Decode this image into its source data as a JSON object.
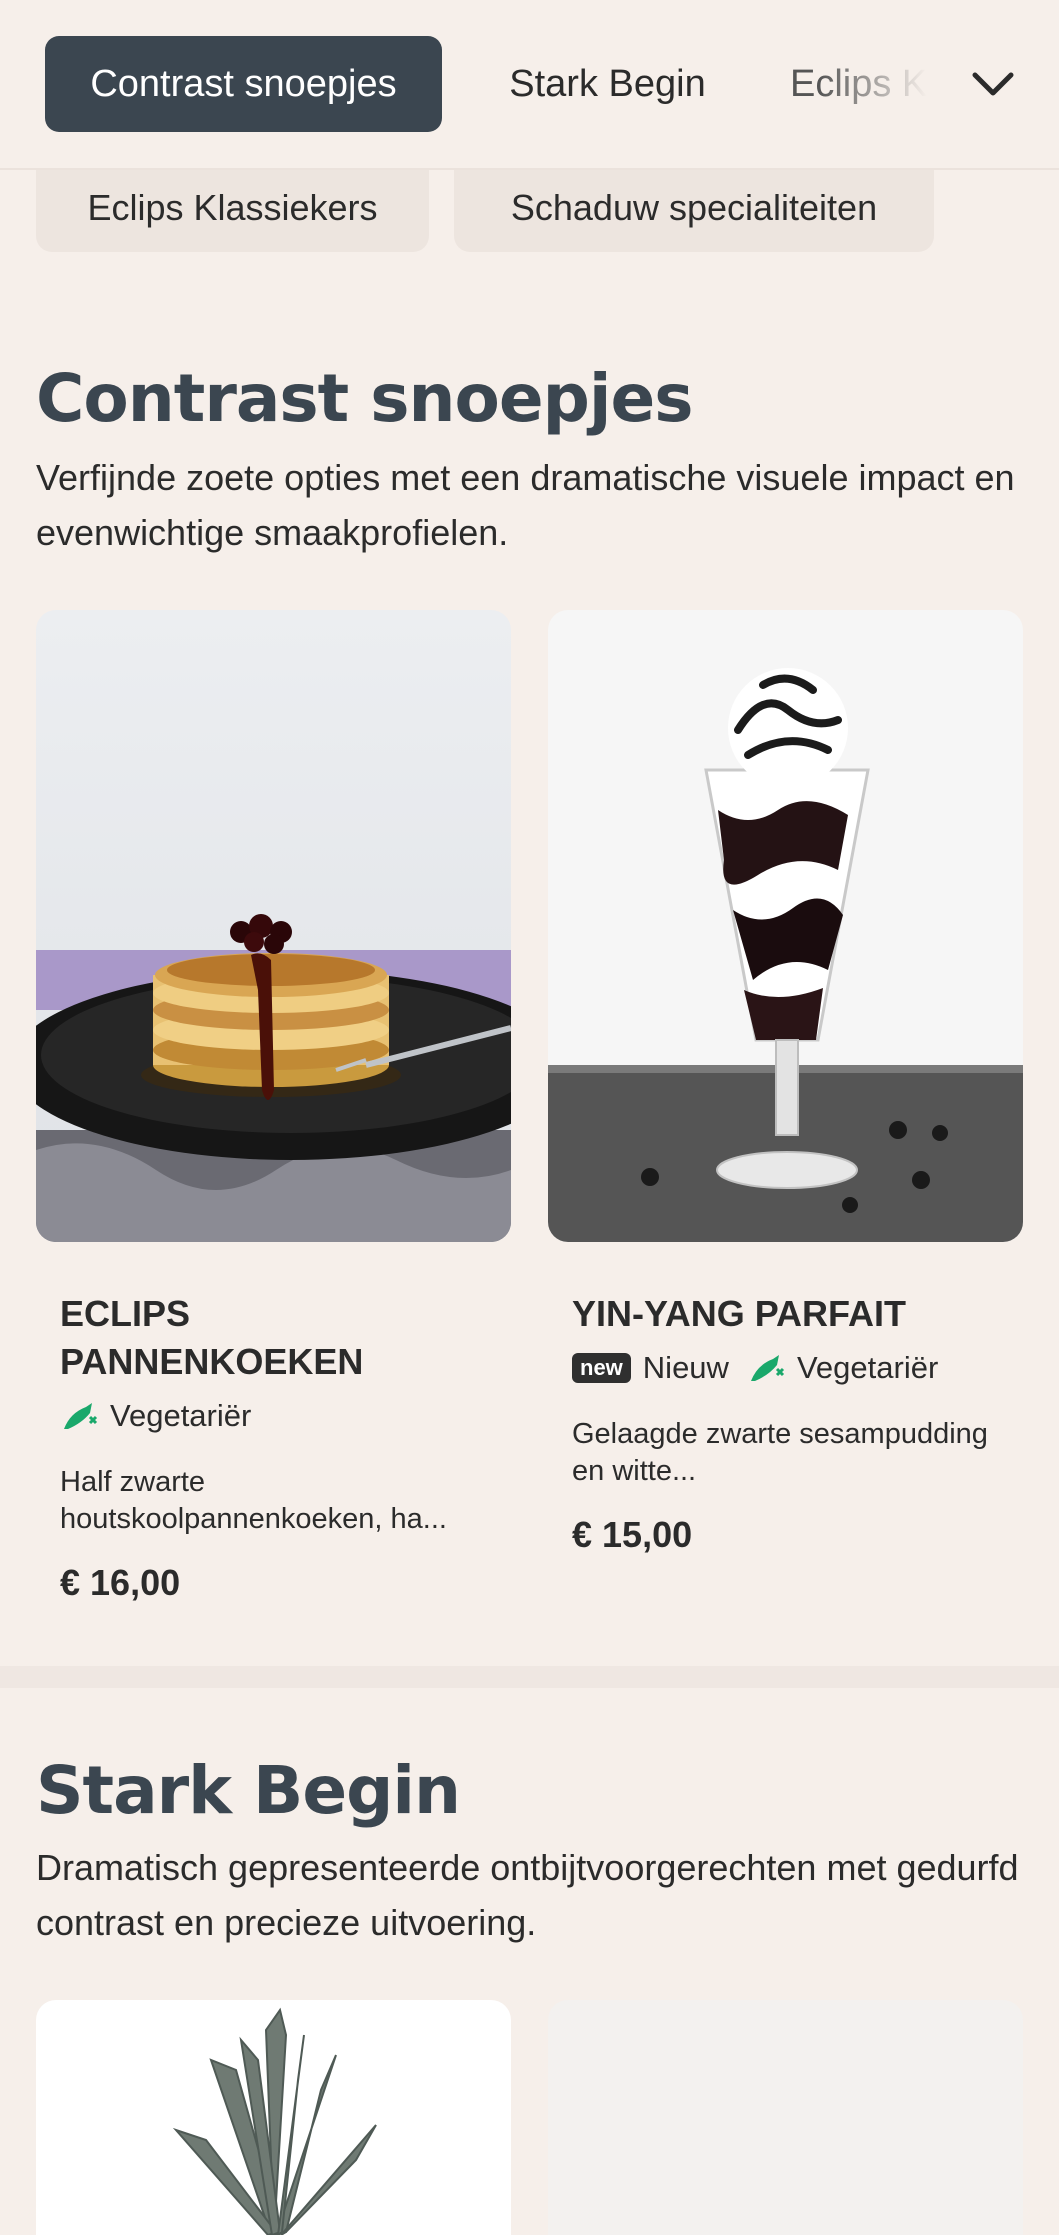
{
  "nav": {
    "tabs": [
      "Contrast snoepjes",
      "Stark Begin",
      "Eclips K"
    ]
  },
  "categories": [
    "Eclips Klassiekers",
    "Schaduw specialiteiten"
  ],
  "sections": [
    {
      "title": "Contrast snoepjes",
      "description": "Verfijnde zoete opties met een dramatische visuele impact en evenwichtige smaakprofielen.",
      "items": [
        {
          "name": "ECLIPS PANNENKOEKEN",
          "tags": [
            {
              "icon": "vegetarian-icon",
              "label": "Vegetariër"
            }
          ],
          "description": "Half zwarte houtskoolpannenkoeken, ha...",
          "price": "€ 16,00"
        },
        {
          "name": "YIN-YANG PARFAIT",
          "badge": "new",
          "tags": [
            {
              "label": "Nieuw"
            },
            {
              "icon": "vegetarian-icon",
              "label": "Vegetariër"
            }
          ],
          "description": "Gelaagde zwarte sesampudding en witte...",
          "price": "€ 15,00"
        }
      ]
    },
    {
      "title": "Stark Begin",
      "description": "Dramatisch gepresenteerde ontbijtvoorgerechten met gedurfd contrast en precieze uitvoering."
    }
  ],
  "colors": {
    "accent": "#3b4650",
    "background": "#f6efea",
    "veg": "#1aa86b"
  }
}
